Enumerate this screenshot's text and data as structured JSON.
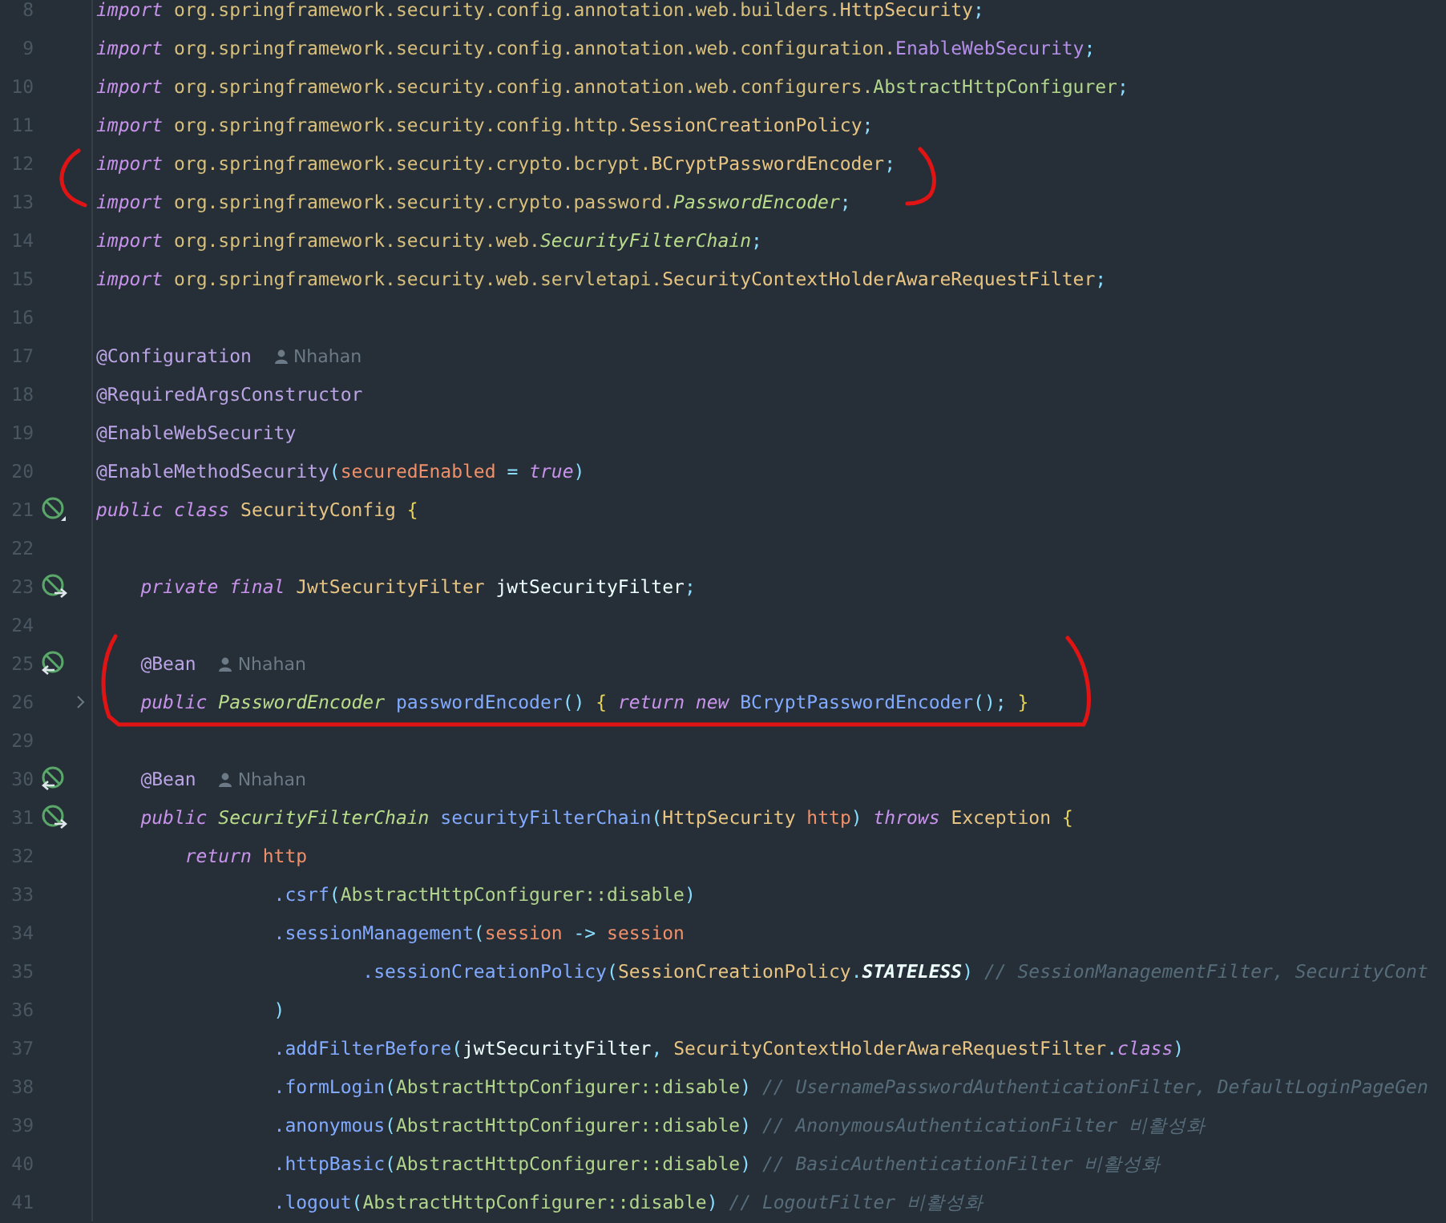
{
  "editor": {
    "lines": [
      {
        "number": "8",
        "tokens": [
          {
            "kind": "kw",
            "text": "import"
          },
          {
            "kind": "pkg",
            "text": " org.springframework.security.config.annotation.web.builders."
          },
          {
            "kind": "cls",
            "text": "HttpSecurity"
          },
          {
            "kind": "punct",
            "text": ";"
          }
        ]
      },
      {
        "number": "9",
        "tokens": [
          {
            "kind": "kw",
            "text": "import"
          },
          {
            "kind": "pkg",
            "text": " org.springframework.security.config.annotation.web.configuration."
          },
          {
            "kind": "anncls",
            "text": "EnableWebSecurity"
          },
          {
            "kind": "punct",
            "text": ";"
          }
        ]
      },
      {
        "number": "10",
        "tokens": [
          {
            "kind": "kw",
            "text": "import"
          },
          {
            "kind": "pkg",
            "text": " org.springframework.security.config.annotation.web.configurers."
          },
          {
            "kind": "ref",
            "text": "AbstractHttpConfigurer"
          },
          {
            "kind": "punct",
            "text": ";"
          }
        ]
      },
      {
        "number": "11",
        "tokens": [
          {
            "kind": "kw",
            "text": "import"
          },
          {
            "kind": "pkg",
            "text": " org.springframework.security.config.http."
          },
          {
            "kind": "cls",
            "text": "SessionCreationPolicy"
          },
          {
            "kind": "punct",
            "text": ";"
          }
        ]
      },
      {
        "number": "12",
        "tokens": [
          {
            "kind": "kw",
            "text": "import"
          },
          {
            "kind": "pkg",
            "text": " org.springframework.security.crypto.bcrypt."
          },
          {
            "kind": "cls",
            "text": "BCryptPasswordEncoder"
          },
          {
            "kind": "punct",
            "text": ";"
          }
        ]
      },
      {
        "number": "13",
        "tokens": [
          {
            "kind": "kw",
            "text": "import"
          },
          {
            "kind": "pkg",
            "text": " org.springframework.security.crypto.password."
          },
          {
            "kind": "iface",
            "text": "PasswordEncoder"
          },
          {
            "kind": "punct",
            "text": ";"
          }
        ]
      },
      {
        "number": "14",
        "tokens": [
          {
            "kind": "kw",
            "text": "import"
          },
          {
            "kind": "pkg",
            "text": " org.springframework.security.web."
          },
          {
            "kind": "iface",
            "text": "SecurityFilterChain"
          },
          {
            "kind": "punct",
            "text": ";"
          }
        ]
      },
      {
        "number": "15",
        "tokens": [
          {
            "kind": "kw",
            "text": "import"
          },
          {
            "kind": "pkg",
            "text": " org.springframework.security.web.servletapi."
          },
          {
            "kind": "cls",
            "text": "SecurityContextHolderAwareRequestFilter"
          },
          {
            "kind": "punct",
            "text": ";"
          }
        ]
      },
      {
        "number": "16"
      },
      {
        "number": "17",
        "tokens": [
          {
            "kind": "ann",
            "text": "@Configuration"
          }
        ],
        "author": "Nhahan"
      },
      {
        "number": "18",
        "tokens": [
          {
            "kind": "ann",
            "text": "@RequiredArgsConstructor"
          }
        ]
      },
      {
        "number": "19",
        "tokens": [
          {
            "kind": "ann",
            "text": "@EnableWebSecurity"
          }
        ]
      },
      {
        "number": "20",
        "tokens": [
          {
            "kind": "ann",
            "text": "@EnableMethodSecurity"
          },
          {
            "kind": "punct",
            "text": "("
          },
          {
            "kind": "param",
            "text": "securedEnabled"
          },
          {
            "kind": "punct",
            "text": " = "
          },
          {
            "kind": "kw",
            "text": "true"
          },
          {
            "kind": "punct",
            "text": ")"
          }
        ]
      },
      {
        "number": "21",
        "gutter": {
          "kind": "bean"
        },
        "tokens": [
          {
            "kind": "kw",
            "text": "public class "
          },
          {
            "kind": "cls",
            "text": "SecurityConfig"
          },
          {
            "kind": "brace",
            "text": " {"
          }
        ]
      },
      {
        "number": "22"
      },
      {
        "number": "23",
        "gutter": {
          "kind": "bean-in"
        },
        "tokens": [
          {
            "kind": "kw",
            "text": "    private final "
          },
          {
            "kind": "cls",
            "text": "JwtSecurityFilter"
          },
          {
            "kind": "plain",
            "text": " jwtSecurityFilter"
          },
          {
            "kind": "punct",
            "text": ";"
          }
        ]
      },
      {
        "number": "24"
      },
      {
        "number": "25",
        "gutter": {
          "kind": "bean-out"
        },
        "tokens": [
          {
            "kind": "ann",
            "text": "    @Bean"
          }
        ],
        "author": "Nhahan"
      },
      {
        "number": "26",
        "folded": true,
        "tokens": [
          {
            "kind": "kw",
            "text": "    public "
          },
          {
            "kind": "iface",
            "text": "PasswordEncoder"
          },
          {
            "kind": "fn",
            "text": " passwordEncoder"
          },
          {
            "kind": "punct",
            "text": "()"
          },
          {
            "kind": "brace",
            "text": " {"
          },
          {
            "kind": "kw",
            "text": " return new "
          },
          {
            "kind": "fn",
            "text": "BCryptPasswordEncoder"
          },
          {
            "kind": "punct",
            "text": "();"
          },
          {
            "kind": "brace",
            "text": " }"
          }
        ]
      },
      {
        "number": "29"
      },
      {
        "number": "30",
        "gutter": {
          "kind": "bean-out"
        },
        "tokens": [
          {
            "kind": "ann",
            "text": "    @Bean"
          }
        ],
        "author": "Nhahan"
      },
      {
        "number": "31",
        "gutter": {
          "kind": "bean-in"
        },
        "tokens": [
          {
            "kind": "kw",
            "text": "    public "
          },
          {
            "kind": "iface",
            "text": "SecurityFilterChain"
          },
          {
            "kind": "fn",
            "text": " securityFilterChain"
          },
          {
            "kind": "punct",
            "text": "("
          },
          {
            "kind": "cls",
            "text": "HttpSecurity"
          },
          {
            "kind": "param",
            "text": " http"
          },
          {
            "kind": "punct",
            "text": ")"
          },
          {
            "kind": "kw",
            "text": " throws "
          },
          {
            "kind": "cls",
            "text": "Exception"
          },
          {
            "kind": "brace",
            "text": " {"
          }
        ]
      },
      {
        "number": "32",
        "tokens": [
          {
            "kind": "kw",
            "text": "        return "
          },
          {
            "kind": "param",
            "text": "http"
          }
        ]
      },
      {
        "number": "33",
        "tokens": [
          {
            "kind": "fn",
            "text": "                .csrf"
          },
          {
            "kind": "punct",
            "text": "("
          },
          {
            "kind": "ref",
            "text": "AbstractHttpConfigurer::disable"
          },
          {
            "kind": "punct",
            "text": ")"
          }
        ]
      },
      {
        "number": "34",
        "tokens": [
          {
            "kind": "fn",
            "text": "                .sessionManagement"
          },
          {
            "kind": "punct",
            "text": "("
          },
          {
            "kind": "param",
            "text": "session"
          },
          {
            "kind": "punct",
            "text": " -> "
          },
          {
            "kind": "param",
            "text": "session"
          }
        ]
      },
      {
        "number": "35",
        "tokens": [
          {
            "kind": "fn",
            "text": "                        .sessionCreationPolicy"
          },
          {
            "kind": "punct",
            "text": "("
          },
          {
            "kind": "cls",
            "text": "SessionCreationPolicy"
          },
          {
            "kind": "punct",
            "text": "."
          },
          {
            "kind": "const",
            "text": "STATELESS"
          },
          {
            "kind": "punct",
            "text": ")"
          },
          {
            "kind": "comment",
            "text": " // SessionManagementFilter, SecurityCont"
          }
        ]
      },
      {
        "number": "36",
        "tokens": [
          {
            "kind": "punct",
            "text": "                )"
          }
        ]
      },
      {
        "number": "37",
        "tokens": [
          {
            "kind": "fn",
            "text": "                .addFilterBefore"
          },
          {
            "kind": "punct",
            "text": "("
          },
          {
            "kind": "plain",
            "text": "jwtSecurityFilter"
          },
          {
            "kind": "punct",
            "text": ", "
          },
          {
            "kind": "cls",
            "text": "SecurityContextHolderAwareRequestFilter"
          },
          {
            "kind": "punct",
            "text": "."
          },
          {
            "kind": "kw",
            "text": "class"
          },
          {
            "kind": "punct",
            "text": ")"
          }
        ]
      },
      {
        "number": "38",
        "tokens": [
          {
            "kind": "fn",
            "text": "                .formLogin"
          },
          {
            "kind": "punct",
            "text": "("
          },
          {
            "kind": "ref",
            "text": "AbstractHttpConfigurer::disable"
          },
          {
            "kind": "punct",
            "text": ")"
          },
          {
            "kind": "comment",
            "text": " // UsernamePasswordAuthenticationFilter, DefaultLoginPageGen"
          }
        ]
      },
      {
        "number": "39",
        "tokens": [
          {
            "kind": "fn",
            "text": "                .anonymous"
          },
          {
            "kind": "punct",
            "text": "("
          },
          {
            "kind": "ref",
            "text": "AbstractHttpConfigurer::disable"
          },
          {
            "kind": "punct",
            "text": ")"
          },
          {
            "kind": "comment",
            "text": " // AnonymousAuthenticationFilter 비활성화"
          }
        ]
      },
      {
        "number": "40",
        "tokens": [
          {
            "kind": "fn",
            "text": "                .httpBasic"
          },
          {
            "kind": "punct",
            "text": "("
          },
          {
            "kind": "ref",
            "text": "AbstractHttpConfigurer::disable"
          },
          {
            "kind": "punct",
            "text": ")"
          },
          {
            "kind": "comment",
            "text": " // BasicAuthenticationFilter 비활성화"
          }
        ]
      },
      {
        "number": "41",
        "tokens": [
          {
            "kind": "fn",
            "text": "                .logout"
          },
          {
            "kind": "punct",
            "text": "("
          },
          {
            "kind": "ref",
            "text": "AbstractHttpConfigurer::disable"
          },
          {
            "kind": "punct",
            "text": ")"
          },
          {
            "kind": "comment",
            "text": " // LogoutFilter 비활성화"
          }
        ]
      }
    ]
  }
}
